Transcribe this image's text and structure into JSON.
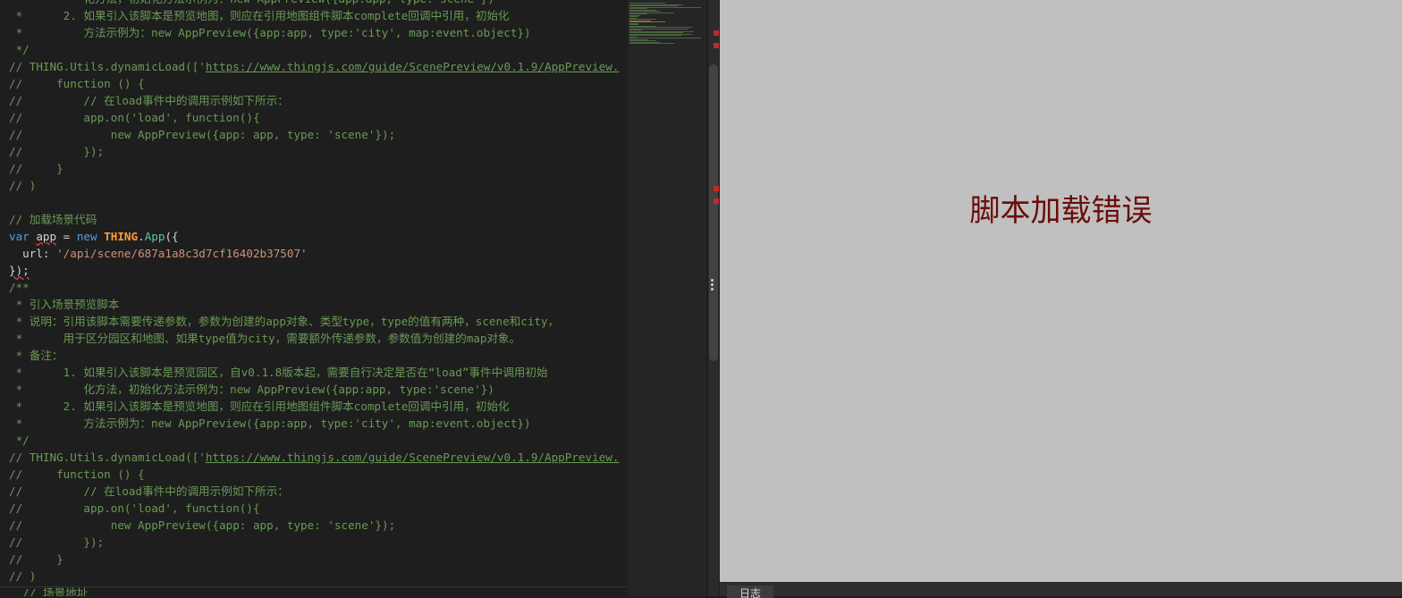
{
  "editor": {
    "partial_top_line": " *         化方法，初始化方法示例为：new AppPreview({app:app, type:'scene'})",
    "lines": [
      " *      2. 如果引入该脚本是预览地图，则应在引用地图组件脚本complete回调中引用，初始化",
      " *         方法示例为：new AppPreview({app:app, type:'city', map:event.object})",
      " */",
      "// THING.Utils.dynamicLoad(['https://www.thingjs.com/guide/ScenePreview/v0.1.9/AppPreview.",
      "//     function () {",
      "//         // 在load事件中的调用示例如下所示：",
      "//         app.on('load', function(){",
      "//             new AppPreview({app: app, type: 'scene'});",
      "//         });",
      "//     }",
      "// )",
      "",
      "// 加载场景代码",
      "var app = new THING.App({",
      "  url: '/api/scene/687a1a8c3d7cf16402b37507'",
      "});",
      "/**",
      " * 引入场景预览脚本",
      " * 说明：引用该脚本需要传递参数，参数为创建的app对象、类型type，type的值有两种，scene和city，",
      " *      用于区分园区和地图、如果type值为city，需要额外传递参数，参数值为创建的map对象。",
      " * 备注：",
      " *      1. 如果引入该脚本是预览园区，自v0.1.8版本起，需要自行决定是否在“load”事件中调用初始",
      " *         化方法，初始化方法示例为：new AppPreview({app:app, type:'scene'})",
      " *      2. 如果引入该脚本是预览地图，则应在引用地图组件脚本complete回调中引用，初始化",
      " *         方法示例为：new AppPreview({app:app, type:'city', map:event.object})",
      " */",
      "// THING.Utils.dynamicLoad(['https://www.thingjs.com/guide/ScenePreview/v0.1.9/AppPreview.",
      "//     function () {",
      "//         // 在load事件中的调用示例如下所示：",
      "//         app.on('load', function(){",
      "//             new AppPreview({app: app, type: 'scene'});",
      "//         });",
      "//     }",
      "// )",
      "  // 场景地址"
    ],
    "code": {
      "var_kw": "var",
      "app_var": "app",
      "eq": " = ",
      "new_kw": "new",
      "thing": "THING",
      "dot": ".",
      "app_cls": "App",
      "open": "({",
      "url_key": "  url: ",
      "url_val": "'/api/scene/687a1a8c3d7cf16402b37507'",
      "close": "});"
    },
    "url_comment_prefix": "// THING.Utils.dynamicLoad(['",
    "url_text": "https://www.thingjs.com/guide/ScenePreview/v0.1.9/AppPreview."
  },
  "preview": {
    "error_message": "脚本加载错误"
  },
  "bottom": {
    "log_tab": "日志"
  },
  "colors": {
    "comment": "#6a9955",
    "keyword": "#569cd6",
    "class": "#ff9d3b",
    "string": "#ce9178",
    "error_text": "#6b0d0d",
    "preview_bg": "#c0c0c0"
  }
}
